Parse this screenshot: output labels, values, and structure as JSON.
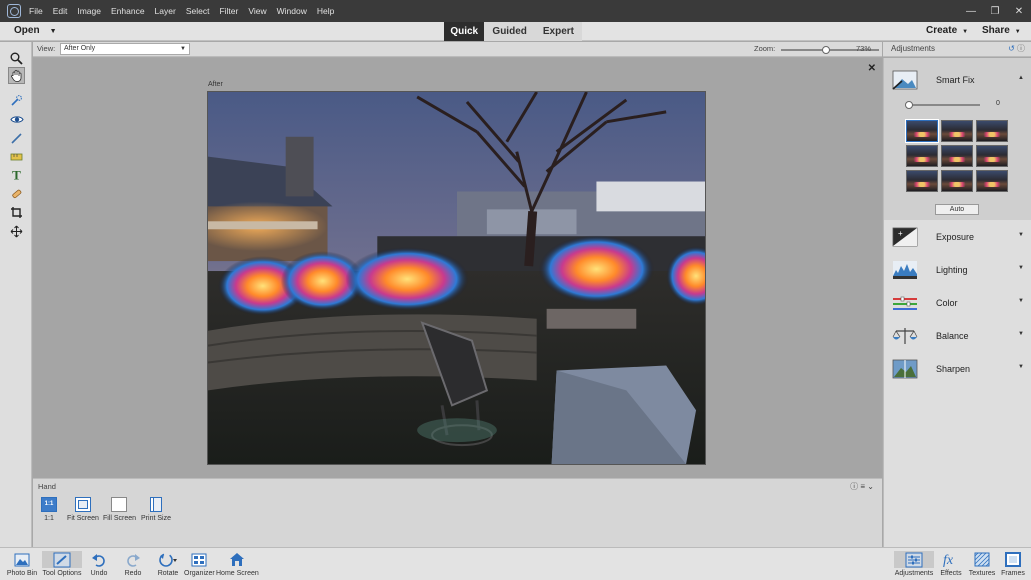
{
  "menubar": {
    "items": [
      "File",
      "Edit",
      "Image",
      "Enhance",
      "Layer",
      "Select",
      "Filter",
      "View",
      "Window",
      "Help"
    ]
  },
  "modebar": {
    "open_label": "Open",
    "tabs": [
      {
        "label": "Quick",
        "active": true
      },
      {
        "label": "Guided",
        "active": false
      },
      {
        "label": "Expert",
        "active": false
      }
    ],
    "create_label": "Create",
    "share_label": "Share"
  },
  "view_strip": {
    "view_label": "View:",
    "view_value": "After Only",
    "zoom_label": "Zoom:",
    "zoom_value": "73%",
    "zoom_fraction": 0.73
  },
  "canvas": {
    "after_label": "After"
  },
  "tool_options": {
    "title": "Hand",
    "options": [
      {
        "label": "1:1",
        "icon_text": "1:1"
      },
      {
        "label": "Fit Screen",
        "icon_text": ""
      },
      {
        "label": "Fill Screen",
        "icon_text": ""
      },
      {
        "label": "Print Size",
        "icon_text": ""
      }
    ]
  },
  "panel": {
    "title": "Adjustments",
    "smart_fix": {
      "label": "Smart Fix",
      "slider_value": "0",
      "auto_label": "Auto"
    },
    "adjustments": [
      {
        "label": "Exposure",
        "icon": "exposure-icon"
      },
      {
        "label": "Lighting",
        "icon": "lighting-icon"
      },
      {
        "label": "Color",
        "icon": "color-icon"
      },
      {
        "label": "Balance",
        "icon": "balance-icon"
      },
      {
        "label": "Sharpen",
        "icon": "sharpen-icon"
      }
    ]
  },
  "bottombar": {
    "left": [
      {
        "label": "Photo Bin",
        "icon": "photo-bin-icon"
      },
      {
        "label": "Tool Options",
        "icon": "tool-options-icon"
      },
      {
        "label": "Undo",
        "icon": "undo-icon"
      },
      {
        "label": "Redo",
        "icon": "redo-icon"
      },
      {
        "label": "Rotate",
        "icon": "rotate-icon"
      },
      {
        "label": "Organizer",
        "icon": "organizer-icon"
      },
      {
        "label": "Home Screen",
        "icon": "home-icon"
      }
    ],
    "right": [
      {
        "label": "Adjustments",
        "icon": "adjustments-icon"
      },
      {
        "label": "Effects",
        "icon": "effects-icon"
      },
      {
        "label": "Textures",
        "icon": "textures-icon"
      },
      {
        "label": "Frames",
        "icon": "frames-icon"
      }
    ]
  },
  "colors": {
    "accent": "#2e6fbd",
    "menubar_bg": "#3a3a3a",
    "active_tab_bg": "#2d2d2d"
  }
}
